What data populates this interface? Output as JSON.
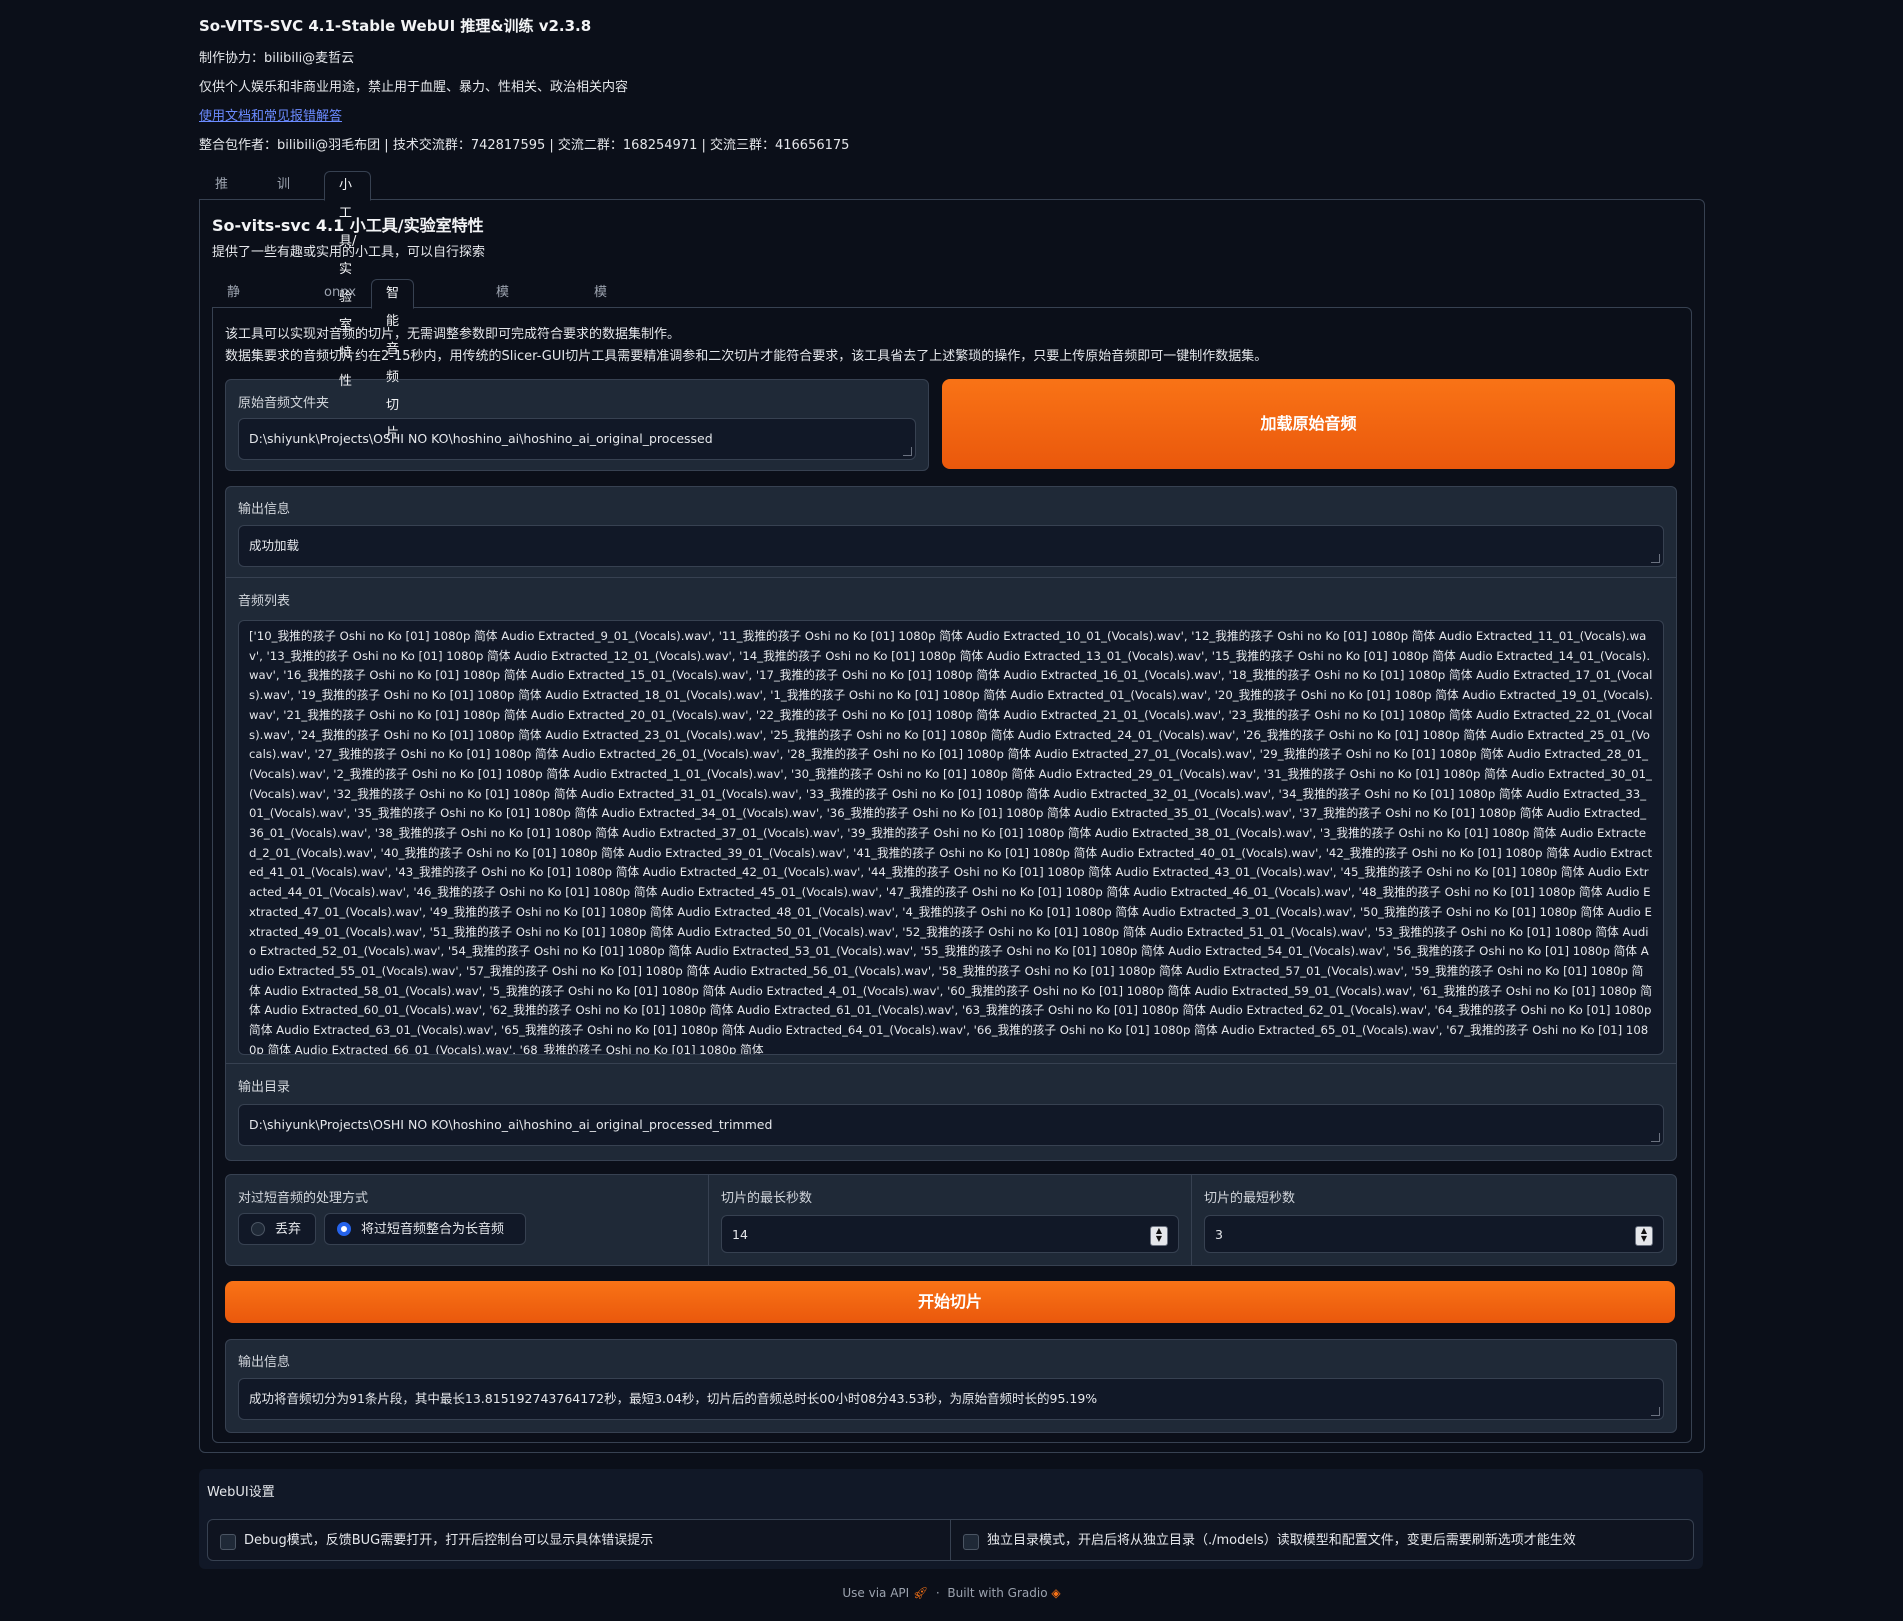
{
  "header": {
    "title": "So-VITS-SVC 4.1-Stable WebUI 推理&训练 v2.3.8",
    "credit": "制作协力：bilibili@麦哲云",
    "notice": "仅供个人娱乐和非商业用途，禁止用于血腥、暴力、性相关、政治相关内容",
    "doc_link": "使用文档和常见报错解答",
    "authors": "整合包作者：bilibili@羽毛布团 | 技术交流群：742817595 | 交流二群：168254971 | 交流三群：416656175"
  },
  "main_tabs": [
    "推理",
    "训练",
    "小工具/实验室特性"
  ],
  "tools": {
    "title": "So-vits-svc 4.1 小工具/实验室特性",
    "subtitle": "提供了一些有趣或实用的小工具，可以自行探索",
    "tabs": [
      "静态声线融合",
      "onnx转换",
      "智能音频切片",
      "模型压缩工具",
      "模型发布打包/安装"
    ]
  },
  "slicer": {
    "desc1": "该工具可以实现对音频的切片，无需调整参数即可完成符合要求的数据集制作。",
    "desc2": "数据集要求的音频切片约在2-15秒内，用传统的Slicer-GUI切片工具需要精准调参和二次切片才能符合要求，该工具省去了上述繁琐的操作，只要上传原始音频即可一键制作数据集。",
    "source_label": "原始音频文件夹",
    "source_value": "D:\\shiyunk\\Projects\\OSHI NO KO\\hoshino_ai\\hoshino_ai_original_processed",
    "load_button": "加载原始音频",
    "output_info_label": "输出信息",
    "output_info_value": "成功加载",
    "list_label": "音频列表",
    "list_value": "['10_我推的孩子 Oshi no Ko [01] 1080p 简体 Audio Extracted_9_01_(Vocals).wav', '11_我推的孩子 Oshi no Ko [01] 1080p 简体 Audio Extracted_10_01_(Vocals).wav', '12_我推的孩子 Oshi no Ko [01] 1080p 简体 Audio Extracted_11_01_(Vocals).wav', '13_我推的孩子 Oshi no Ko [01] 1080p 简体 Audio Extracted_12_01_(Vocals).wav', '14_我推的孩子 Oshi no Ko [01] 1080p 简体 Audio Extracted_13_01_(Vocals).wav', '15_我推的孩子 Oshi no Ko [01] 1080p 简体 Audio Extracted_14_01_(Vocals).wav', '16_我推的孩子 Oshi no Ko [01] 1080p 简体 Audio Extracted_15_01_(Vocals).wav', '17_我推的孩子 Oshi no Ko [01] 1080p 简体 Audio Extracted_16_01_(Vocals).wav', '18_我推的孩子 Oshi no Ko [01] 1080p 简体 Audio Extracted_17_01_(Vocals).wav', '19_我推的孩子 Oshi no Ko [01] 1080p 简体 Audio Extracted_18_01_(Vocals).wav', '1_我推的孩子 Oshi no Ko [01] 1080p 简体 Audio Extracted_01_(Vocals).wav', '20_我推的孩子 Oshi no Ko [01] 1080p 简体 Audio Extracted_19_01_(Vocals).wav', '21_我推的孩子 Oshi no Ko [01] 1080p 简体 Audio Extracted_20_01_(Vocals).wav', '22_我推的孩子 Oshi no Ko [01] 1080p 简体 Audio Extracted_21_01_(Vocals).wav', '23_我推的孩子 Oshi no Ko [01] 1080p 简体 Audio Extracted_22_01_(Vocals).wav', '24_我推的孩子 Oshi no Ko [01] 1080p 简体 Audio Extracted_23_01_(Vocals).wav', '25_我推的孩子 Oshi no Ko [01] 1080p 简体 Audio Extracted_24_01_(Vocals).wav', '26_我推的孩子 Oshi no Ko [01] 1080p 简体 Audio Extracted_25_01_(Vocals).wav', '27_我推的孩子 Oshi no Ko [01] 1080p 简体 Audio Extracted_26_01_(Vocals).wav', '28_我推的孩子 Oshi no Ko [01] 1080p 简体 Audio Extracted_27_01_(Vocals).wav', '29_我推的孩子 Oshi no Ko [01] 1080p 简体 Audio Extracted_28_01_(Vocals).wav', '2_我推的孩子 Oshi no Ko [01] 1080p 简体 Audio Extracted_1_01_(Vocals).wav', '30_我推的孩子 Oshi no Ko [01] 1080p 简体 Audio Extracted_29_01_(Vocals).wav', '31_我推的孩子 Oshi no Ko [01] 1080p 简体 Audio Extracted_30_01_(Vocals).wav', '32_我推的孩子 Oshi no Ko [01] 1080p 简体 Audio Extracted_31_01_(Vocals).wav', '33_我推的孩子 Oshi no Ko [01] 1080p 简体 Audio Extracted_32_01_(Vocals).wav', '34_我推的孩子 Oshi no Ko [01] 1080p 简体 Audio Extracted_33_01_(Vocals).wav', '35_我推的孩子 Oshi no Ko [01] 1080p 简体 Audio Extracted_34_01_(Vocals).wav', '36_我推的孩子 Oshi no Ko [01] 1080p 简体 Audio Extracted_35_01_(Vocals).wav', '37_我推的孩子 Oshi no Ko [01] 1080p 简体 Audio Extracted_36_01_(Vocals).wav', '38_我推的孩子 Oshi no Ko [01] 1080p 简体 Audio Extracted_37_01_(Vocals).wav', '39_我推的孩子 Oshi no Ko [01] 1080p 简体 Audio Extracted_38_01_(Vocals).wav', '3_我推的孩子 Oshi no Ko [01] 1080p 简体 Audio Extracted_2_01_(Vocals).wav', '40_我推的孩子 Oshi no Ko [01] 1080p 简体 Audio Extracted_39_01_(Vocals).wav', '41_我推的孩子 Oshi no Ko [01] 1080p 简体 Audio Extracted_40_01_(Vocals).wav', '42_我推的孩子 Oshi no Ko [01] 1080p 简体 Audio Extracted_41_01_(Vocals).wav', '43_我推的孩子 Oshi no Ko [01] 1080p 简体 Audio Extracted_42_01_(Vocals).wav', '44_我推的孩子 Oshi no Ko [01] 1080p 简体 Audio Extracted_43_01_(Vocals).wav', '45_我推的孩子 Oshi no Ko [01] 1080p 简体 Audio Extracted_44_01_(Vocals).wav', '46_我推的孩子 Oshi no Ko [01] 1080p 简体 Audio Extracted_45_01_(Vocals).wav', '47_我推的孩子 Oshi no Ko [01] 1080p 简体 Audio Extracted_46_01_(Vocals).wav', '48_我推的孩子 Oshi no Ko [01] 1080p 简体 Audio Extracted_47_01_(Vocals).wav', '49_我推的孩子 Oshi no Ko [01] 1080p 简体 Audio Extracted_48_01_(Vocals).wav', '4_我推的孩子 Oshi no Ko [01] 1080p 简体 Audio Extracted_3_01_(Vocals).wav', '50_我推的孩子 Oshi no Ko [01] 1080p 简体 Audio Extracted_49_01_(Vocals).wav', '51_我推的孩子 Oshi no Ko [01] 1080p 简体 Audio Extracted_50_01_(Vocals).wav', '52_我推的孩子 Oshi no Ko [01] 1080p 简体 Audio Extracted_51_01_(Vocals).wav', '53_我推的孩子 Oshi no Ko [01] 1080p 简体 Audio Extracted_52_01_(Vocals).wav', '54_我推的孩子 Oshi no Ko [01] 1080p 简体 Audio Extracted_53_01_(Vocals).wav', '55_我推的孩子 Oshi no Ko [01] 1080p 简体 Audio Extracted_54_01_(Vocals).wav', '56_我推的孩子 Oshi no Ko [01] 1080p 简体 Audio Extracted_55_01_(Vocals).wav', '57_我推的孩子 Oshi no Ko [01] 1080p 简体 Audio Extracted_56_01_(Vocals).wav', '58_我推的孩子 Oshi no Ko [01] 1080p 简体 Audio Extracted_57_01_(Vocals).wav', '59_我推的孩子 Oshi no Ko [01] 1080p 简体 Audio Extracted_58_01_(Vocals).wav', '5_我推的孩子 Oshi no Ko [01] 1080p 简体 Audio Extracted_4_01_(Vocals).wav', '60_我推的孩子 Oshi no Ko [01] 1080p 简体 Audio Extracted_59_01_(Vocals).wav', '61_我推的孩子 Oshi no Ko [01] 1080p 简体 Audio Extracted_60_01_(Vocals).wav', '62_我推的孩子 Oshi no Ko [01] 1080p 简体 Audio Extracted_61_01_(Vocals).wav', '63_我推的孩子 Oshi no Ko [01] 1080p 简体 Audio Extracted_62_01_(Vocals).wav', '64_我推的孩子 Oshi no Ko [01] 1080p 简体 Audio Extracted_63_01_(Vocals).wav', '65_我推的孩子 Oshi no Ko [01] 1080p 简体 Audio Extracted_64_01_(Vocals).wav', '66_我推的孩子 Oshi no Ko [01] 1080p 简体 Audio Extracted_65_01_(Vocals).wav', '67_我推的孩子 Oshi no Ko [01] 1080p 简体 Audio Extracted_66_01_(Vocals).wav', '68_我推的孩子 Oshi no Ko [01] 1080p 简体",
    "output_dir_label": "输出目录",
    "output_dir_value": "D:\\shiyunk\\Projects\\OSHI NO KO\\hoshino_ai\\hoshino_ai_original_processed_trimmed",
    "short_audio_label": "对过短音频的处理方式",
    "short_audio_options": [
      "丢弃",
      "将过短音频整合为长音频"
    ],
    "short_audio_selected": "将过短音频整合为长音频",
    "max_sec_label": "切片的最长秒数",
    "max_sec_value": "14",
    "min_sec_label": "切片的最短秒数",
    "min_sec_value": "3",
    "start_button": "开始切片",
    "result_label": "输出信息",
    "result_value": "成功将音频切分为91条片段，其中最长13.815192743764172秒，最短3.04秒，切片后的音频总时长00小时08分43.53秒，为原始音频时长的95.19%"
  },
  "settings": {
    "title": "WebUI设置",
    "debug": "Debug模式，反馈BUG需要打开，打开后控制台可以显示具体错误提示",
    "standalone": "独立目录模式，开启后将从独立目录（./models）读取模型和配置文件，变更后需要刷新选项才能生效"
  },
  "footer": {
    "api": "Use via API",
    "sep": "·",
    "built": "Built with Gradio"
  },
  "colors": {
    "accent": "#f97316",
    "background": "#0b0f19",
    "link": "#6b8bff"
  }
}
